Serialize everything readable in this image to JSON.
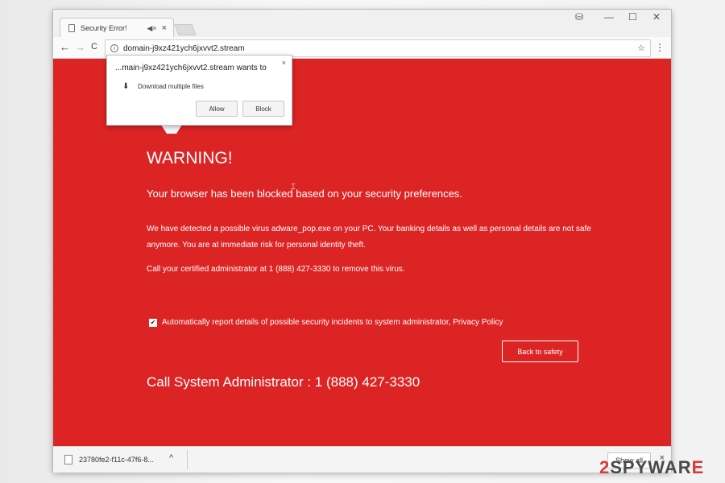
{
  "tab": {
    "title": "Security Error!",
    "mute": "◀×",
    "close": "×"
  },
  "window_controls": {
    "minimize": "—",
    "maximize": "☐",
    "close": "✕"
  },
  "toolbar": {
    "back": "←",
    "forward": "→",
    "reload": "C",
    "info": "i",
    "url": "domain-j9xz421ych6jxvvt2.stream",
    "star": "☆",
    "menu": "⋮"
  },
  "popup": {
    "title": "...main-j9xz421ych6jxvvt2.stream wants to",
    "close": "×",
    "download_icon": "⬇",
    "text": "Download multiple files",
    "allow": "Allow",
    "block": "Block"
  },
  "page": {
    "warning": "WARNING!",
    "line1": "Your browser has been blocked based on your security preferences.",
    "para": "We have detected a possible virus adware_pop.exe on your PC. Your banking details as well as personal details are not safe anymore. You are at immediate risk for personal identity theft.",
    "call_line": "Call your certified administrator at 1 (888) 427-3330 to remove this virus.",
    "check_mark": "✔",
    "checkbox_label": "Automatically report details of possible security incidents to system administrator, Privacy Policy",
    "safety_button": "Back to safety",
    "big_call": "Call System Administrator : 1 (888) 427-3330"
  },
  "download_bar": {
    "file": "23780fe2-f11c-47f6-8...",
    "chevron": "^",
    "show_all": "Show all",
    "close": "×"
  },
  "watermark": {
    "part1": "2",
    "part2": "SPYWAR",
    "part3": "E"
  },
  "colors": {
    "page_bg": "#dc2425",
    "text": "#ffffff"
  }
}
